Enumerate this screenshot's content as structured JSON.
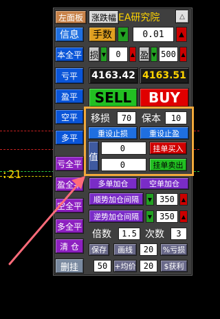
{
  "chart": {
    "label_fragment": ":21",
    "colors": {
      "red_dash": "#cc2222",
      "green_dash": "#2ecc40",
      "yellow_dash": "#e0d000"
    }
  },
  "top": {
    "left_panel_button": "左面板",
    "zhang_die_button": "涨跌幅",
    "title": "EA研究院",
    "close_icon": "triangle-up-icon"
  },
  "row2": {
    "info_button": "信息",
    "lot_button": "手数",
    "lot_value": "0.01"
  },
  "row3": {
    "close_all_button": "本全平",
    "stop_label": "损",
    "stop_value": "0",
    "profit_label": "盈",
    "profit_value": "500"
  },
  "row4": {
    "loss_close_button": "亏平",
    "bid_price": "4163.42",
    "ask_price": "4163.51"
  },
  "row5": {
    "profit_close_button": "盈平",
    "sell_button": "SELL",
    "buy_button": "BUY"
  },
  "row6": {
    "short_close_button": "空平",
    "move_stop_label": "移损",
    "move_stop_value": "70",
    "breakeven_label": "保本",
    "breakeven_value": "10"
  },
  "row7": {
    "long_close_button": "多平",
    "reset_stop_button": "重设止损",
    "reset_profit_button": "重设止盈"
  },
  "row8": {
    "value_label": "值",
    "pending_buy_value": "0",
    "pending_buy_button": "挂单买入",
    "pending_sell_value": "0",
    "pending_sell_button": "挂单卖出",
    "loss_all_close_button": "亏全平"
  },
  "row9": {
    "profit_all_close_button": "盈全平",
    "long_add_button": "多单加仓",
    "short_add_button": "空单加仓"
  },
  "row10": {
    "empty_all_close_button": "空全平",
    "trend_add_interval_button": "顺势加仓间隔",
    "trend_add_interval_value": "350"
  },
  "row11": {
    "long_all_close_button": "多全平",
    "counter_add_interval_button": "逆势加仓间隔",
    "counter_add_interval_value": "350"
  },
  "row12": {
    "multiplier_label": "倍数",
    "multiplier_value": "1.5",
    "count_label": "次数",
    "count_value": "3",
    "clear_button": "清 仓"
  },
  "row13": {
    "save_button": "保存",
    "draw_line_button": "画线",
    "pct_value": "20",
    "pct_loss_button": "%亏损"
  },
  "row14": {
    "delete_pending_button": "删挂",
    "avg_base_value": "50",
    "avg_label": "+均价",
    "take_profit_value": "20",
    "take_profit_button": "$获利"
  }
}
